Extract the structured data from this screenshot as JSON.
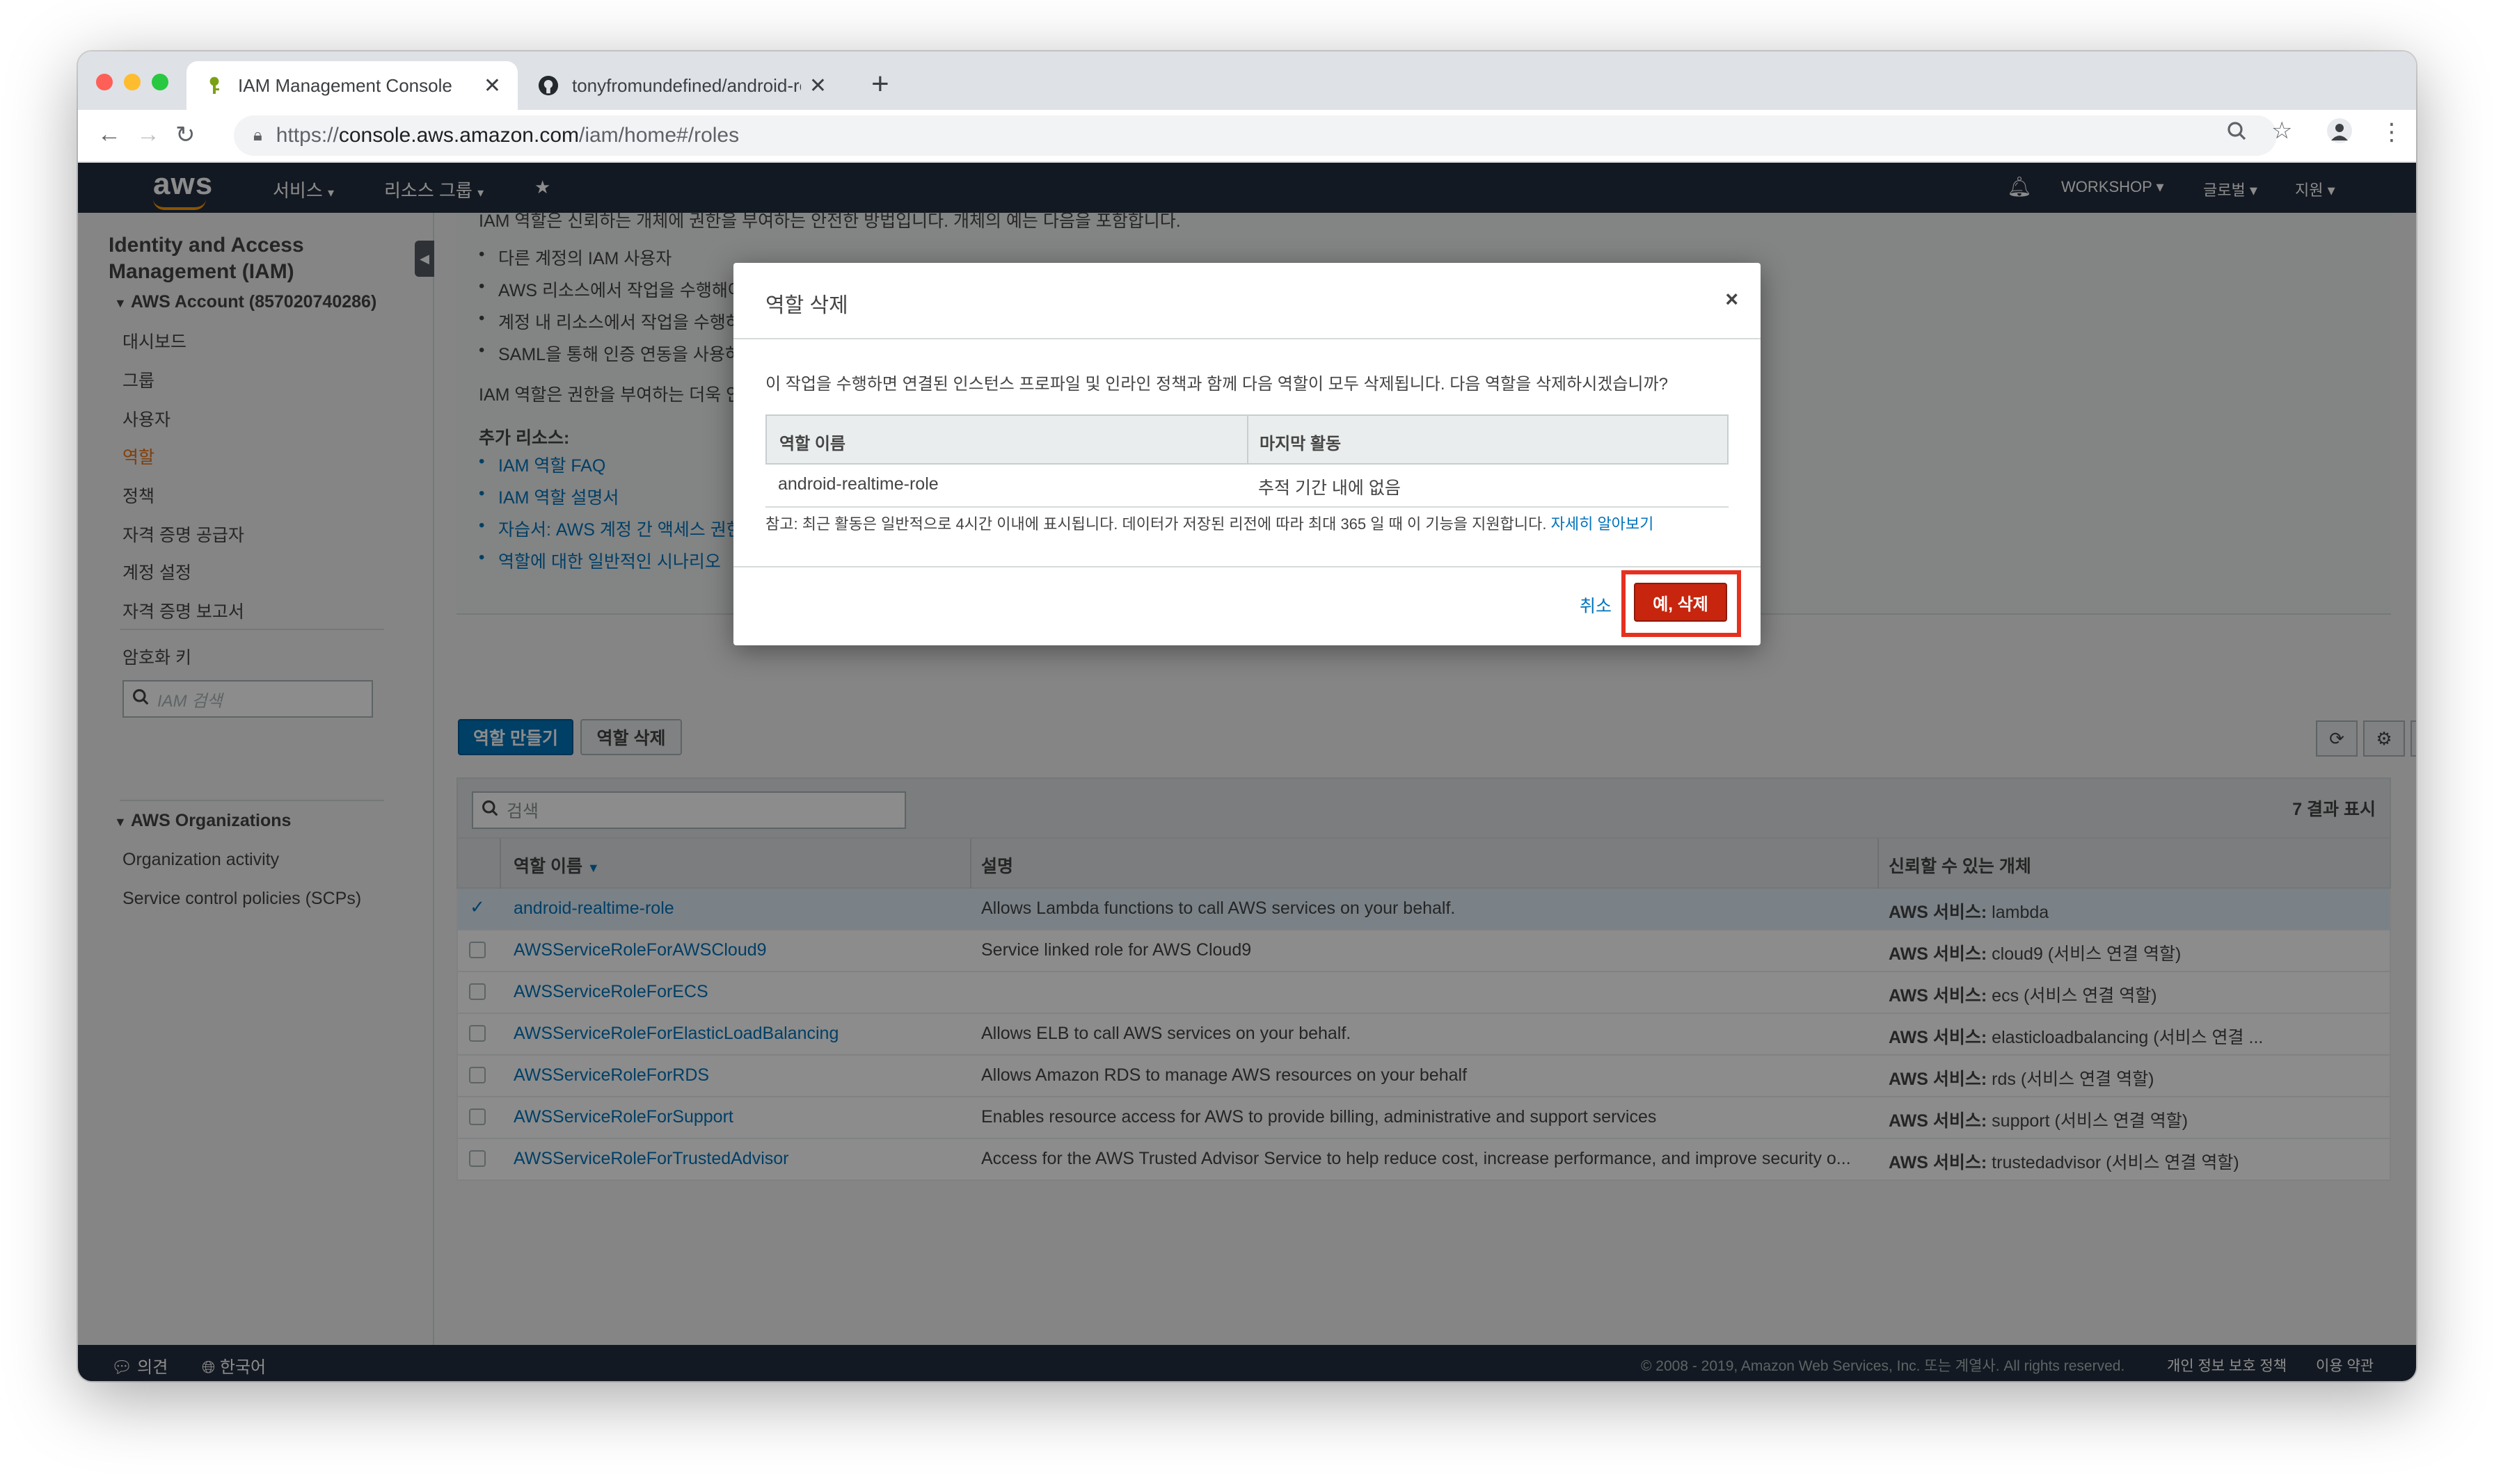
{
  "browser": {
    "tabs": [
      {
        "title": "IAM Management Console",
        "active": true
      },
      {
        "title": "tonyfromundefined/android-re",
        "active": false
      }
    ],
    "new_tab": "+",
    "url_scheme": "https://",
    "url_host": "console.aws.amazon.com",
    "url_path": "/iam/home#/roles"
  },
  "aws_header": {
    "logo": "aws",
    "services": "서비스",
    "resource_groups": "리소스 그룹",
    "account": "WORKSHOP",
    "region": "글로벌",
    "support": "지원"
  },
  "sidebar": {
    "title": "Identity and Access Management (IAM)",
    "account_section": "AWS Account (857020740286)",
    "items": [
      "대시보드",
      "그룹",
      "사용자",
      "역할",
      "정책",
      "자격 증명 공급자",
      "계정 설정",
      "자격 증명 보고서"
    ],
    "active_item": "역할",
    "encryption_keys": "암호화 키",
    "search_placeholder": "IAM 검색",
    "org_section": "AWS Organizations",
    "org_items": [
      "Organization activity",
      "Service control policies (SCPs)"
    ]
  },
  "info": {
    "intro": "IAM 역할은 신뢰하는 개체에 권한을 부여하는 안전한 방법입니다. 개체의 예는 다음을 포함합니다.",
    "bullets": [
      "다른 계정의 IAM 사용자",
      "AWS 리소스에서 작업을 수행해야",
      "계정 내 리소스에서 작업을 수행하",
      "SAML을 통해 인증 연동을 사용하"
    ],
    "note": "IAM 역할은 권한을 부여하는 더욱 안",
    "resources_title": "추가 리소스:",
    "links": [
      "IAM 역할 FAQ",
      "IAM 역할 설명서",
      "자습서: AWS 계정 간 액세스 권한",
      "역할에 대한 일반적인 시나리오"
    ]
  },
  "actions": {
    "create_role": "역할 만들기",
    "delete_role": "역할 삭제"
  },
  "table": {
    "search_placeholder": "검색",
    "result_count": "7 결과 표시",
    "headers": [
      "역할 이름",
      "설명",
      "신뢰할 수 있는 개체"
    ],
    "rows": [
      {
        "name": "android-realtime-role",
        "desc": "Allows Lambda functions to call AWS services on your behalf.",
        "trust_label": "AWS 서비스:",
        "trust": "lambda",
        "checked": true
      },
      {
        "name": "AWSServiceRoleForAWSCloud9",
        "desc": "Service linked role for AWS Cloud9",
        "trust_label": "AWS 서비스:",
        "trust": "cloud9 (서비스 연결 역할)",
        "checked": false
      },
      {
        "name": "AWSServiceRoleForECS",
        "desc": "",
        "trust_label": "AWS 서비스:",
        "trust": "ecs (서비스 연결 역할)",
        "checked": false
      },
      {
        "name": "AWSServiceRoleForElasticLoadBalancing",
        "desc": "Allows ELB to call AWS services on your behalf.",
        "trust_label": "AWS 서비스:",
        "trust": "elasticloadbalancing (서비스 연결 ...",
        "checked": false
      },
      {
        "name": "AWSServiceRoleForRDS",
        "desc": "Allows Amazon RDS to manage AWS resources on your behalf",
        "trust_label": "AWS 서비스:",
        "trust": "rds (서비스 연결 역할)",
        "checked": false
      },
      {
        "name": "AWSServiceRoleForSupport",
        "desc": "Enables resource access for AWS to provide billing, administrative and support services",
        "trust_label": "AWS 서비스:",
        "trust": "support (서비스 연결 역할)",
        "checked": false
      },
      {
        "name": "AWSServiceRoleForTrustedAdvisor",
        "desc": "Access for the AWS Trusted Advisor Service to help reduce cost, increase performance, and improve security o...",
        "trust_label": "AWS 서비스:",
        "trust": "trustedadvisor (서비스 연결 역할)",
        "checked": false
      }
    ]
  },
  "modal": {
    "title": "역할 삭제",
    "body": "이 작업을 수행하면 연결된 인스턴스 프로파일 및 인라인 정책과 함께 다음 역할이 모두 삭제됩니다. 다음 역할을 삭제하시겠습니까?",
    "col_name": "역할 이름",
    "col_activity": "마지막 활동",
    "role_name": "android-realtime-role",
    "role_activity": "추적 기간 내에 없음",
    "note": "참고: 최근 활동은 일반적으로 4시간 이내에 표시됩니다. 데이터가 저장된 리전에 따라 최대 365 일 때 이 기능을 지원합니다.",
    "learn_more": "자세히 알아보기",
    "cancel": "취소",
    "confirm": "예, 삭제"
  },
  "footer": {
    "feedback": "의견",
    "language": "한국어",
    "copyright": "© 2008 - 2019, Amazon Web Services, Inc. 또는 계열사. All rights reserved.",
    "privacy": "개인 정보 보호 정책",
    "terms": "이용 약관"
  },
  "colors": {
    "aws_navy": "#232f3e",
    "aws_orange": "#ec7211",
    "link_blue": "#0073bb",
    "danger_red": "#c7250e",
    "highlight_red": "#e53020"
  }
}
